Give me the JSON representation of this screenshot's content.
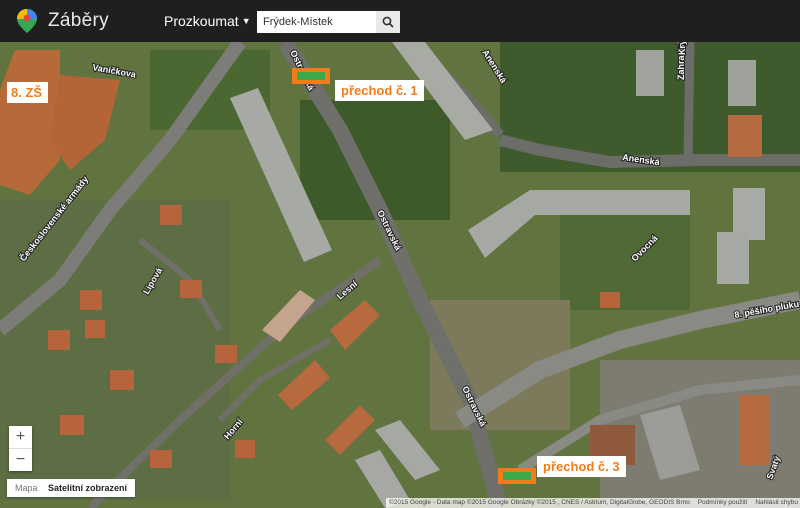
{
  "header": {
    "app_title": "Záběry",
    "nav_label": "Prozkoumat",
    "search_value": "Frýdek-Místek"
  },
  "map": {
    "school_label": "8. ZŠ",
    "crossing_1_label": "přechod č. 1",
    "crossing_3_label": "přechod č. 3",
    "streets": {
      "ostravska_upper": "Ostravská",
      "ostravska_mid": "Ostravská",
      "ostravska_lower": "Ostravská",
      "anenska_upper": "Anenská",
      "anenska_right": "Anenská",
      "ceskoslovenske_armady": "Československé armády",
      "pesiho_pluku": "8. pěšího pluku",
      "ovocna": "Ovocná",
      "lipova": "Lipová",
      "lesni": "Lesní",
      "horni": "Horní",
      "zahradni": "Zahradní",
      "vanickova": "Vaníčkova",
      "kryta": "Krytá",
      "street_far_right": "Svatý"
    }
  },
  "controls": {
    "zoom_in": "+",
    "zoom_out": "−",
    "maptype_map": "Mapa",
    "maptype_satellite": "Satelitní zobrazení"
  },
  "attribution": {
    "copyright": "©2015 Google - Data map ©2015 Google Obrázky ©2015 , CNES / Astrium, DigitalGlobe, GEODIS Brno",
    "terms": "Podmínky použití",
    "report": "Nahlásit chybu"
  },
  "colors": {
    "marker_orange": "#f07c1b",
    "marker_green": "#3ea84a",
    "header_bg": "#1f1f1f"
  }
}
